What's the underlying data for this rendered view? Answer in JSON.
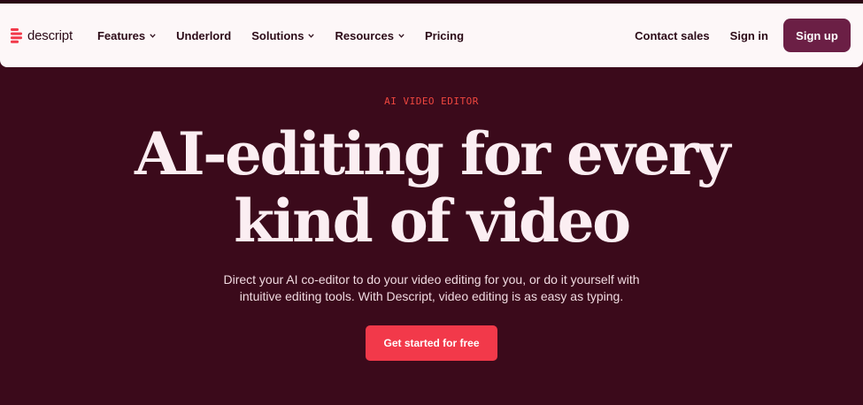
{
  "brand": {
    "name": "descript",
    "icon": "descript-logo-icon"
  },
  "nav": {
    "items": [
      {
        "label": "Features",
        "dropdown": true
      },
      {
        "label": "Underlord",
        "dropdown": false
      },
      {
        "label": "Solutions",
        "dropdown": true
      },
      {
        "label": "Resources",
        "dropdown": true
      },
      {
        "label": "Pricing",
        "dropdown": false
      }
    ],
    "contact_label": "Contact sales",
    "signin_label": "Sign in",
    "signup_label": "Sign up"
  },
  "hero": {
    "eyebrow": "AI VIDEO EDITOR",
    "headline_line1": "AI-editing for every",
    "headline_line2": "kind of video",
    "subtitle_line1": "Direct your AI co-editor to do your video editing for you, or do it yourself with",
    "subtitle_line2": "intuitive editing tools. With Descript, video editing is as easy as typing.",
    "cta_label": "Get started for free"
  },
  "colors": {
    "background": "#3b0a1b",
    "nav_background": "#fdf7f8",
    "signup_button": "#6b1f45",
    "cta_button": "#f2394a",
    "eyebrow": "#f0473f",
    "headline": "#fbeef2"
  }
}
